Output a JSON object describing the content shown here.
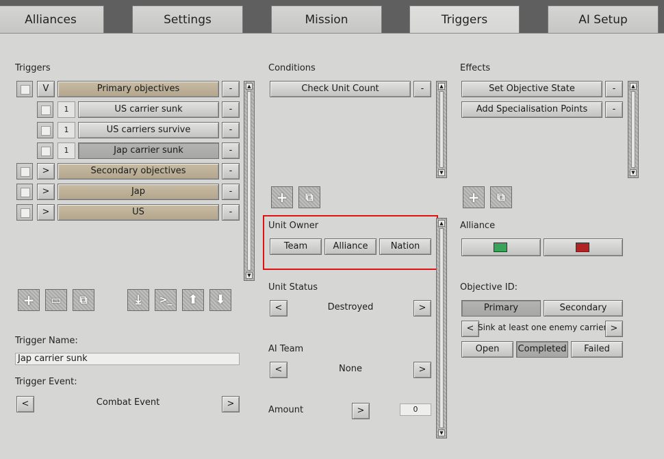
{
  "tabs": [
    {
      "label": "Alliances"
    },
    {
      "label": "Settings"
    },
    {
      "label": "Mission"
    },
    {
      "label": "Triggers"
    },
    {
      "label": "AI Setup"
    }
  ],
  "triggers": {
    "heading": "Triggers",
    "rows": [
      {
        "toggle": "V",
        "label": "Primary objectives",
        "remove": "-"
      },
      {
        "num": "1",
        "label": "US carrier sunk",
        "remove": "-"
      },
      {
        "num": "1",
        "label": "US carriers survive",
        "remove": "-"
      },
      {
        "num": "1",
        "label": "Jap carrier sunk",
        "remove": "-"
      },
      {
        "toggle": ">",
        "label": "Secondary objectives",
        "remove": "-"
      },
      {
        "toggle": ">",
        "label": "Jap",
        "remove": "-"
      },
      {
        "toggle": ">",
        "label": "US",
        "remove": "-"
      }
    ],
    "name_label": "Trigger Name:",
    "name_value": "Jap carrier sunk",
    "event_label": "Trigger Event:",
    "event_value": "Combat Event",
    "prev": "<",
    "next": ">"
  },
  "conditions": {
    "heading": "Conditions",
    "items": [
      {
        "label": "Check Unit Count",
        "remove": "-"
      }
    ],
    "unit_owner": {
      "heading": "Unit Owner",
      "options": [
        "Team",
        "Alliance",
        "Nation"
      ]
    },
    "unit_status": {
      "heading": "Unit Status",
      "value": "Destroyed",
      "prev": "<",
      "next": ">"
    },
    "ai_team": {
      "heading": "AI Team",
      "value": "None",
      "prev": "<",
      "next": ">"
    },
    "amount": {
      "heading": "Amount",
      "next": ">",
      "value": "0"
    }
  },
  "effects": {
    "heading": "Effects",
    "items": [
      {
        "label": "Set Objective State",
        "remove": "-"
      },
      {
        "label": "Add Specialisation Points",
        "remove": "-"
      }
    ],
    "alliance": {
      "heading": "Alliance",
      "colors": [
        "#3aa35a",
        "#b02424"
      ]
    },
    "objective": {
      "heading": "Objective ID:",
      "types": [
        "Primary",
        "Secondary"
      ],
      "text": "Sink at least one enemy carrier.",
      "prev": "<",
      "next": ">",
      "states": [
        "Open",
        "Completed",
        "Failed"
      ]
    }
  },
  "icons": {
    "add": "+",
    "copy": "⧉",
    "folder": "▭",
    "import": "⤓",
    "console": ">_",
    "up": "⬆",
    "down": "⬇"
  }
}
